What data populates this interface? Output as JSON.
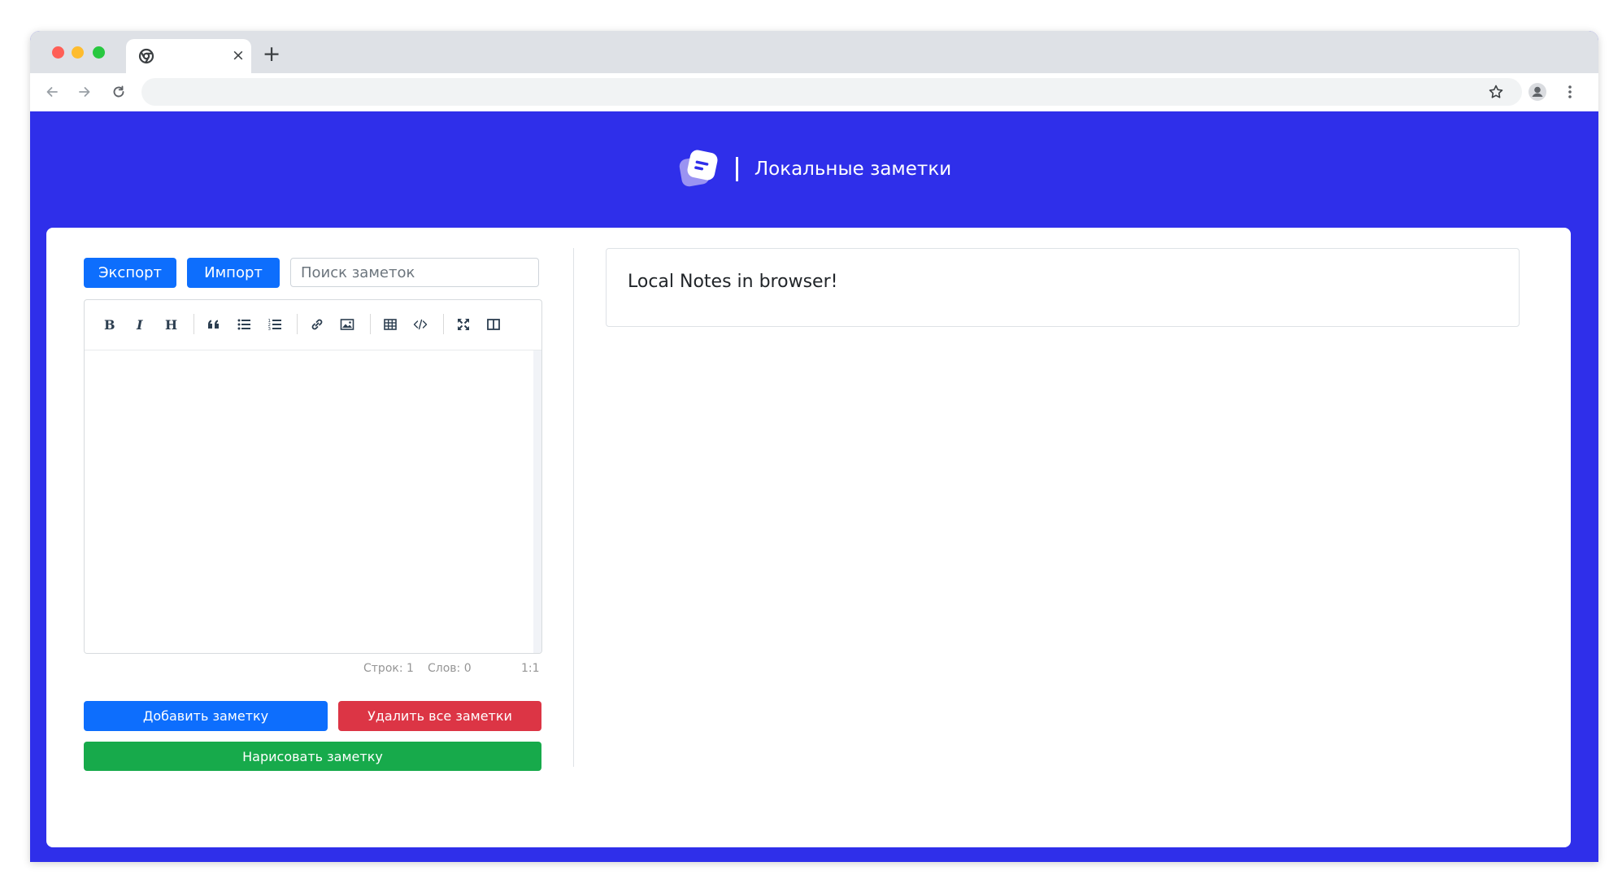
{
  "browser": {
    "tab_close": "×",
    "new_tab": "+",
    "address": ""
  },
  "header": {
    "title": "Локальные заметки"
  },
  "controls": {
    "export_label": "Экспорт",
    "import_label": "Импорт",
    "search_placeholder": "Поиск заметок"
  },
  "editor": {
    "toolbar": [
      "bold",
      "italic",
      "heading",
      "quote",
      "unordered-list",
      "ordered-list",
      "link",
      "image",
      "table",
      "code",
      "fullscreen",
      "side-by-side"
    ],
    "content": "",
    "status": {
      "lines": "Строк: 1",
      "words": "Слов: 0",
      "cursor": "1:1"
    }
  },
  "actions": {
    "add_label": "Добавить заметку",
    "delete_all_label": "Удалить все заметки",
    "draw_label": "Нарисовать заметку"
  },
  "notes": [
    {
      "text": "Local Notes in browser!"
    }
  ],
  "colors": {
    "page_bg": "#2f2fea",
    "primary": "#0d6efd",
    "danger": "#dc3545",
    "success": "#17aa4b"
  }
}
